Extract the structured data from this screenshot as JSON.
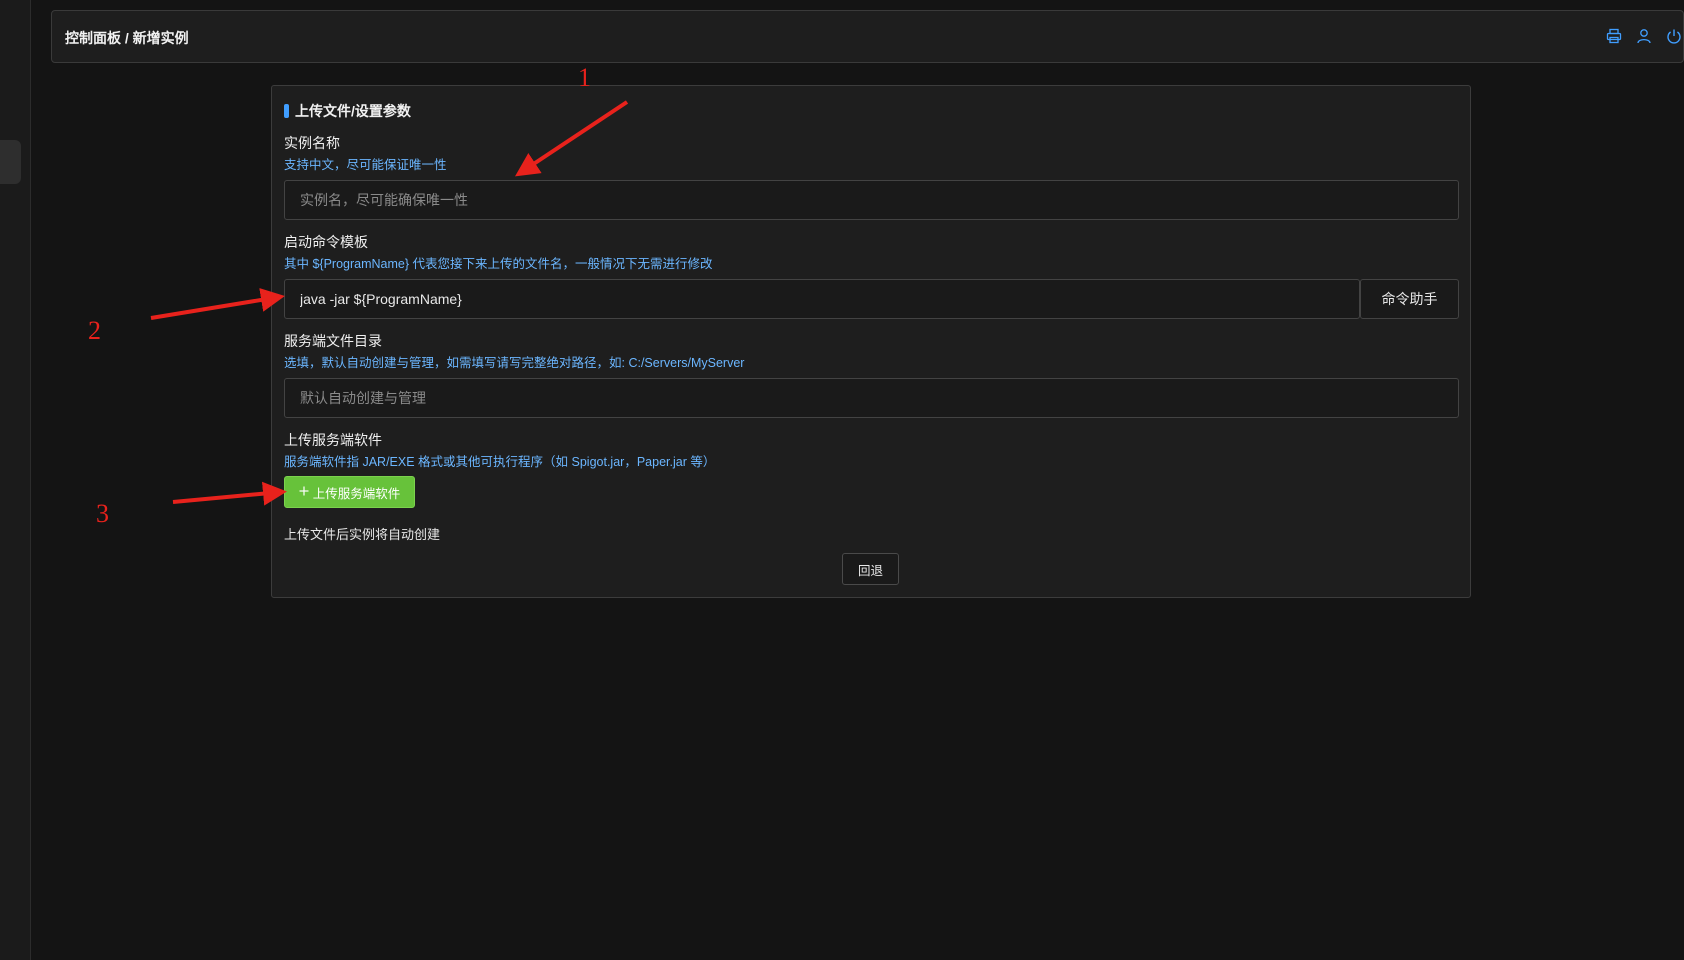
{
  "header": {
    "breadcrumb": "控制面板 / 新增实例",
    "icons": [
      "printer-icon",
      "user-icon",
      "power-icon"
    ],
    "accent": "#409eff"
  },
  "card": {
    "title": "上传文件/设置参数",
    "instance_name": {
      "label": "实例名称",
      "hint": "支持中文，尽可能保证唯一性",
      "placeholder": "实例名，尽可能确保唯一性",
      "value": ""
    },
    "start_command": {
      "label": "启动命令模板",
      "hint": "其中 ${ProgramName} 代表您接下来上传的文件名，一般情况下无需进行修改",
      "value": "java -jar ${ProgramName}",
      "helper_label": "命令助手"
    },
    "server_dir": {
      "label": "服务端文件目录",
      "hint": "选填，默认自动创建与管理，如需填写请写完整绝对路径，如: C:/Servers/MyServer",
      "placeholder": "默认自动创建与管理",
      "value": ""
    },
    "upload": {
      "label": "上传服务端软件",
      "hint": "服务端软件指 JAR/EXE 格式或其他可执行程序（如 Spigot.jar，Paper.jar 等）",
      "button_label": "上传服务端软件",
      "button_color": "#67c23a"
    },
    "auto_note": "上传文件后实例将自动创建",
    "back_label": "回退"
  },
  "annotations": {
    "color": "#e8221c",
    "labels": [
      "1",
      "2",
      "3"
    ]
  }
}
